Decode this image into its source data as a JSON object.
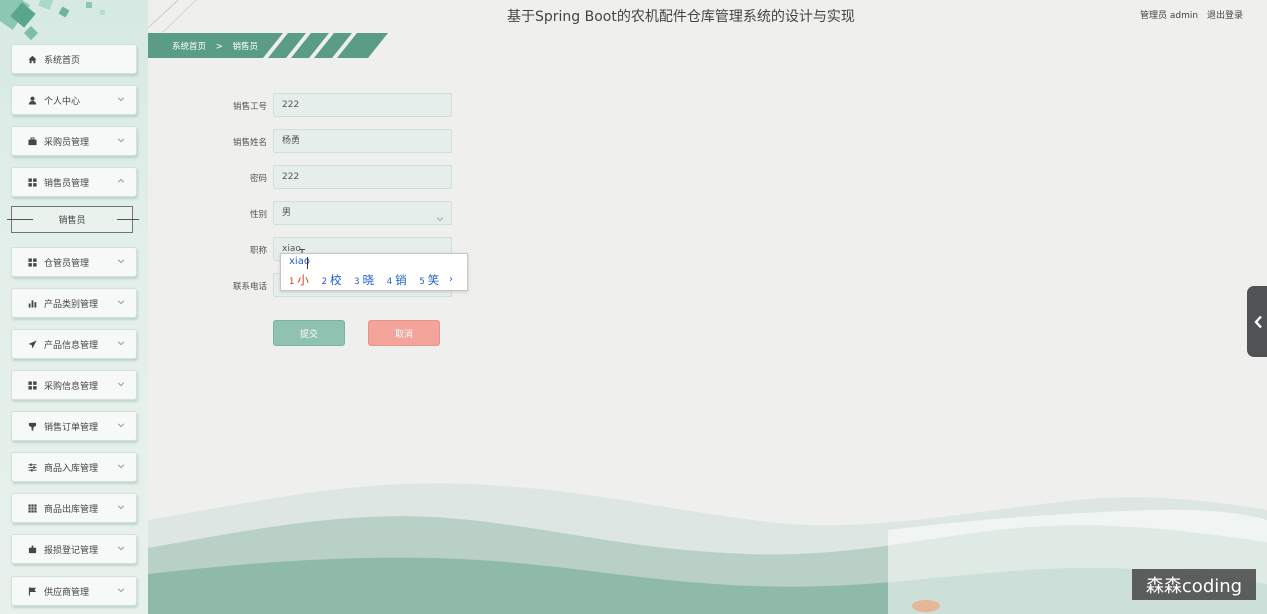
{
  "header": {
    "title": "基于Spring Boot的农机配件仓库管理系统的设计与实现",
    "user_label": "管理员 admin",
    "logout_label": "退出登录"
  },
  "breadcrumb": {
    "home": "系统首页",
    "separator": ">",
    "current": "销售员"
  },
  "sidebar": {
    "items": [
      {
        "label": "系统首页",
        "icon": "home-icon",
        "has_arrow": false
      },
      {
        "label": "个人中心",
        "icon": "user-icon",
        "has_arrow": true
      },
      {
        "label": "采购员管理",
        "icon": "briefcase-icon",
        "has_arrow": true
      },
      {
        "label": "销售员管理",
        "icon": "grid-icon",
        "has_arrow": true,
        "expanded": true
      },
      {
        "label": "仓管员管理",
        "icon": "grid-icon",
        "has_arrow": true
      },
      {
        "label": "产品类别管理",
        "icon": "bar-chart-icon",
        "has_arrow": true
      },
      {
        "label": "产品信息管理",
        "icon": "send-icon",
        "has_arrow": true
      },
      {
        "label": "采购信息管理",
        "icon": "grid-icon",
        "has_arrow": true
      },
      {
        "label": "销售订单管理",
        "icon": "cup-icon",
        "has_arrow": true
      },
      {
        "label": "商品入库管理",
        "icon": "sliders-icon",
        "has_arrow": true
      },
      {
        "label": "商品出库管理",
        "icon": "table-icon",
        "has_arrow": true
      },
      {
        "label": "报损登记管理",
        "icon": "puzzle-icon",
        "has_arrow": true
      },
      {
        "label": "供应商管理",
        "icon": "flag-icon",
        "has_arrow": true
      }
    ],
    "submenu_active": "销售员"
  },
  "form": {
    "employee_id": {
      "label": "销售工号",
      "value": "222"
    },
    "name": {
      "label": "销售姓名",
      "value": "杨勇"
    },
    "password": {
      "label": "密码",
      "value": "222"
    },
    "gender": {
      "label": "性别",
      "value": "男"
    },
    "title": {
      "label": "职称",
      "value": "xiao"
    },
    "phone": {
      "label": "联系电话",
      "value": ""
    },
    "submit_label": "提交",
    "cancel_label": "取消"
  },
  "ime": {
    "composition": "xiao",
    "candidates": [
      {
        "num": "1",
        "char": "小"
      },
      {
        "num": "2",
        "char": "校"
      },
      {
        "num": "3",
        "char": "晓"
      },
      {
        "num": "4",
        "char": "销"
      },
      {
        "num": "5",
        "char": "笑"
      }
    ],
    "next": "›"
  },
  "watermark": "森森coding",
  "colors": {
    "accent_green": "#4e9a83",
    "submit_button": "#8fc2b0",
    "cancel_button": "#f3a49b",
    "ime_text": "#1a5fc8",
    "ime_active": "#e0391e"
  }
}
